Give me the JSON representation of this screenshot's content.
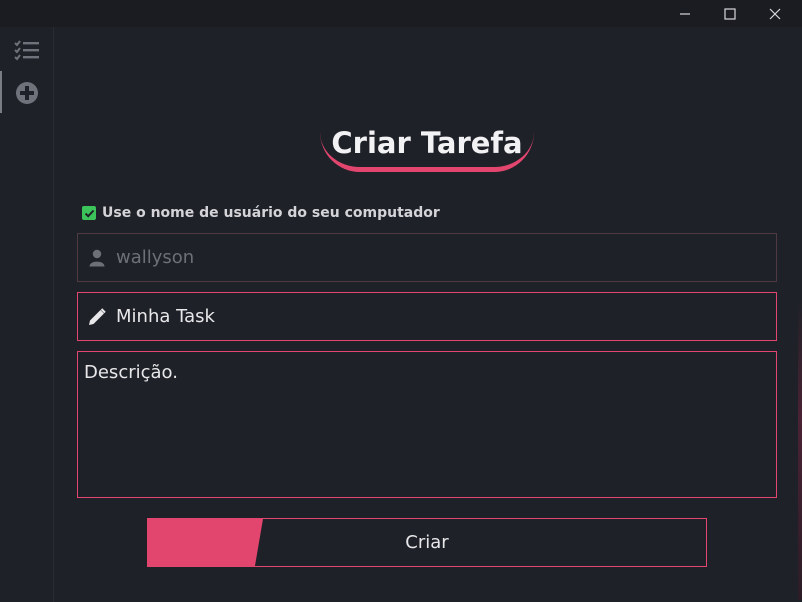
{
  "window": {
    "controls": [
      "minimize",
      "maximize",
      "close"
    ]
  },
  "sidebar": {
    "items": [
      {
        "name": "tasks",
        "icon": "task-list-icon"
      },
      {
        "name": "add",
        "icon": "add-circle-icon",
        "active": true
      }
    ]
  },
  "form": {
    "title": "Criar Tarefa",
    "use_username_checkbox": {
      "label": "Use o nome de usuário do seu computador",
      "checked": true
    },
    "username_field": {
      "value": "wallyson",
      "icon": "user-icon"
    },
    "task_name_field": {
      "value": "Minha Task",
      "icon": "pencil-icon"
    },
    "description_field": {
      "value": "Descrição."
    },
    "submit_label": "Criar"
  },
  "colors": {
    "accent": "#e2466f",
    "background": "#1f2128",
    "checkbox": "#3cc45a"
  }
}
